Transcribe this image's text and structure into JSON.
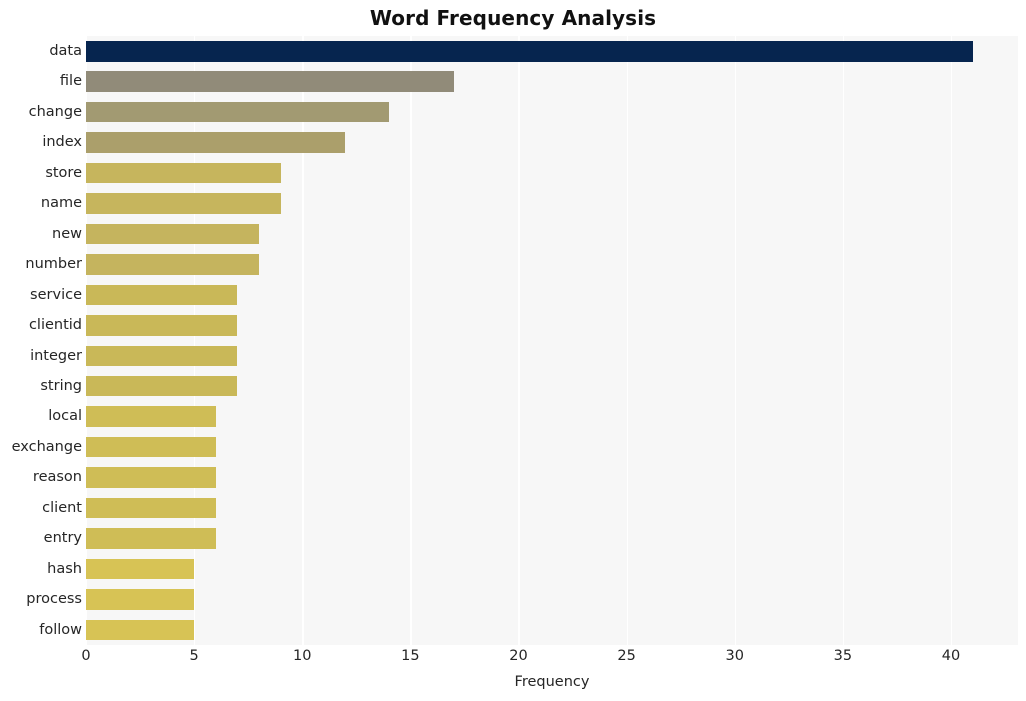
{
  "chart_data": {
    "type": "bar",
    "orientation": "horizontal",
    "title": "Word Frequency Analysis",
    "xlabel": "Frequency",
    "ylabel": "",
    "categories": [
      "data",
      "file",
      "change",
      "index",
      "store",
      "name",
      "new",
      "number",
      "service",
      "clientid",
      "integer",
      "string",
      "local",
      "exchange",
      "reason",
      "client",
      "entry",
      "hash",
      "process",
      "follow"
    ],
    "values": [
      41,
      17,
      14,
      12,
      9,
      9,
      8,
      8,
      7,
      7,
      7,
      7,
      6,
      6,
      6,
      6,
      6,
      5,
      5,
      5
    ],
    "xlim": [
      0,
      43.1
    ],
    "xticks": [
      0,
      5,
      10,
      15,
      20,
      25,
      30,
      35,
      40
    ],
    "xticklabels": [
      "0",
      "5",
      "10",
      "15",
      "20",
      "25",
      "30",
      "35",
      "40"
    ],
    "grid": "vertical-only",
    "legend": "none",
    "bar_colors": [
      "#06254f",
      "#918b79",
      "#a29a72",
      "#ab9f6b",
      "#c6b55d",
      "#c6b55d",
      "#c5b45e",
      "#c5b45e",
      "#c9b858",
      "#c9b858",
      "#c9b858",
      "#c9b858",
      "#cfbd56",
      "#cfbd56",
      "#cfbd56",
      "#cfbd56",
      "#cfbd56",
      "#d7c355",
      "#d7c355",
      "#d7c355"
    ],
    "plot_background": "#f7f7f7",
    "gridline_color": "#ffffff",
    "figure_background": "#ffffff"
  }
}
